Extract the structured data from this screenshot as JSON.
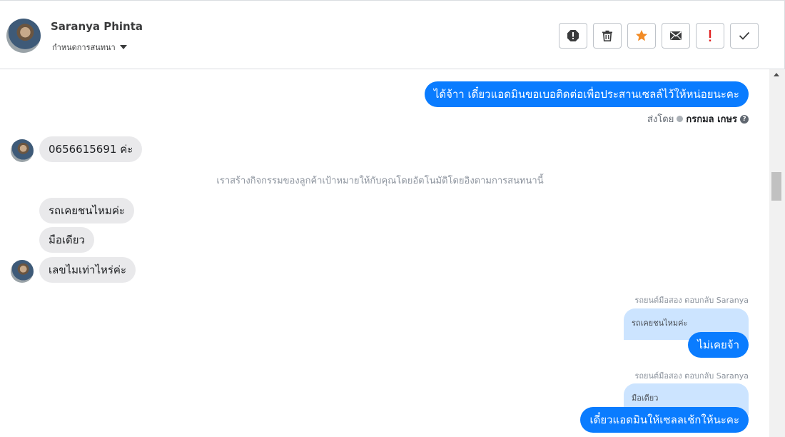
{
  "header": {
    "contact_name": "Saranya Phinta",
    "status_label": "กำหนดการสนทนา",
    "tools": [
      {
        "name": "spam-icon",
        "color": "#3a3b3c"
      },
      {
        "name": "trash-icon",
        "color": "#3a3b3c"
      },
      {
        "name": "star-icon",
        "color": "#f28b25"
      },
      {
        "name": "envelope-icon",
        "color": "#3a3b3c"
      },
      {
        "name": "exclamation-icon",
        "color": "#e02020"
      },
      {
        "name": "check-icon",
        "color": "#3a3b3c"
      }
    ]
  },
  "conversation": {
    "msg1": "ได้จ้าา เดี๋ยวแอดมินขอเบอติดต่อเพื่อประสานเซลล์ไว้ให้หน่อยนะคะ",
    "sent_by_label": "ส่งโดย",
    "sent_by_name": "กรกมล เกษร",
    "msg2": "0656615691 ค่ะ",
    "system_note": "เราสร้างกิจกรรมของลูกค้าเป้าหมายให้กับคุณโดยอัตโนมัติโดยอิงตามการสนทนานี้",
    "msg3": "รถเคยชนไหมค่ะ",
    "msg4": "มือเดียว",
    "msg5": "เลขไมเท่าไหร่ค่ะ",
    "reply1_meta": "รถยนต์มือสอง ตอบกลับ Saranya",
    "reply1_quote": "รถเคยชนไหมค่ะ",
    "reply1_text": "ไม่เคยจ้า",
    "reply2_meta": "รถยนต์มือสอง ตอบกลับ Saranya",
    "reply2_quote": "มือเดียว",
    "reply2_text": "เดี๋ยวแอดมินให้เซลลเช้กให้นะคะ"
  },
  "colors": {
    "outgoing_bubble": "#0a7cff",
    "incoming_bubble": "#e9e9eb",
    "quote_bubble": "#cce4ff"
  }
}
